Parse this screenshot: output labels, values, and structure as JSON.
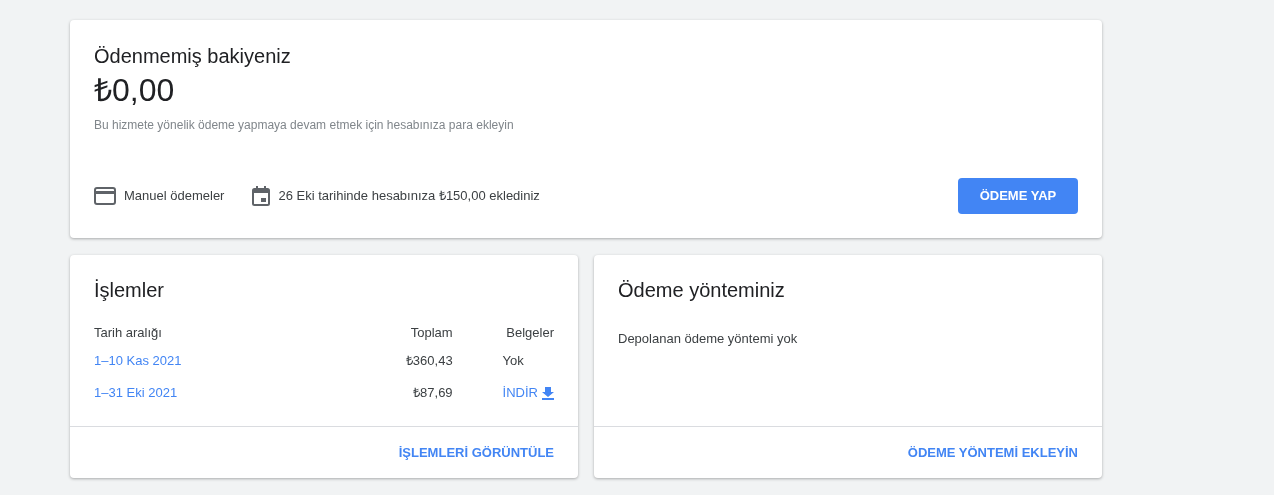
{
  "balance": {
    "title": "Ödenmemiş bakiyeniz",
    "amount": "₺0,00",
    "note": "Bu hizmete yönelik ödeme yapmaya devam etmek için hesabınıza para ekleyin",
    "info": [
      {
        "kind": "card",
        "text": "Manuel ödemeler"
      },
      {
        "kind": "calendar",
        "text": "26 Eki tarihinde hesabınıza ₺150,00 eklediniz"
      }
    ],
    "button": "ÖDEME YAP"
  },
  "transactions": {
    "title": "İşlemler",
    "columns": [
      "Tarih aralığı",
      "Toplam",
      "Belgeler"
    ],
    "rows": [
      {
        "range": "1–10 Kas 2021",
        "total": "₺360,43",
        "document": {
          "kind": "none",
          "text": "Yok"
        }
      },
      {
        "range": "1–31 Eki 2021",
        "total": "₺87,69",
        "document": {
          "kind": "download",
          "text": "İNDİR"
        }
      }
    ],
    "action": "İŞLEMLERİ GÖRÜNTÜLE"
  },
  "payment_method": {
    "title": "Ödeme yönteminiz",
    "message": "Depolanan ödeme yöntemi yok",
    "action": "ÖDEME YÖNTEMİ EKLEYİN"
  }
}
